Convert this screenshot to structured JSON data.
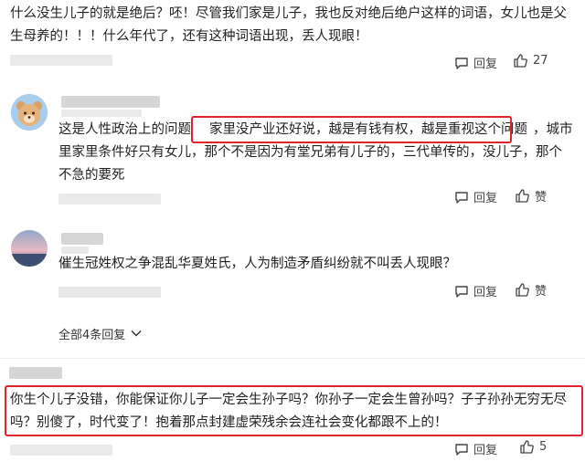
{
  "comment1": {
    "lines": [
      "什么没生儿子的就是绝后？呸！尽管我们家是儿子，我也反对绝后绝户这样的词语，女儿也是父",
      "生母养的！！！什么年代了，还有这种词语出现，丢人现眼！"
    ],
    "reply_label": "回复",
    "like_count": "27"
  },
  "comment2": {
    "line1_pre": "这是人性政治上的问题",
    "line1_highlight": "家里没产业还好说，越是有钱有权，越是重视这个问题",
    "line1_post": "，城市",
    "line2": "里家里条件好只有女儿，那个不是因为有堂兄弟有儿子的，三代单传的，没儿子，那个",
    "line3": "不急的要死",
    "reply_label": "回复",
    "like_label": "赞"
  },
  "comment3": {
    "text": "催生冠姓权之争混乱华夏姓氏，人为制造矛盾纠纷就不叫丢人现眼？",
    "reply_label": "回复",
    "like_label": "赞"
  },
  "expand": {
    "label": "全部4条回复"
  },
  "comment4": {
    "lines": [
      "你生个儿子没错，你能保证你儿子一定会生孙子吗？你孙子一定会生曾孙吗？子子孙孙无穷无尽",
      "吗？别傻了，时代变了！抱着那点封建虚荣残余会连社会变化都跟不上的！"
    ],
    "reply_label": "回复",
    "like_count": "5"
  },
  "colors": {
    "highlight_border": "#e0242e",
    "text": "#222222"
  }
}
